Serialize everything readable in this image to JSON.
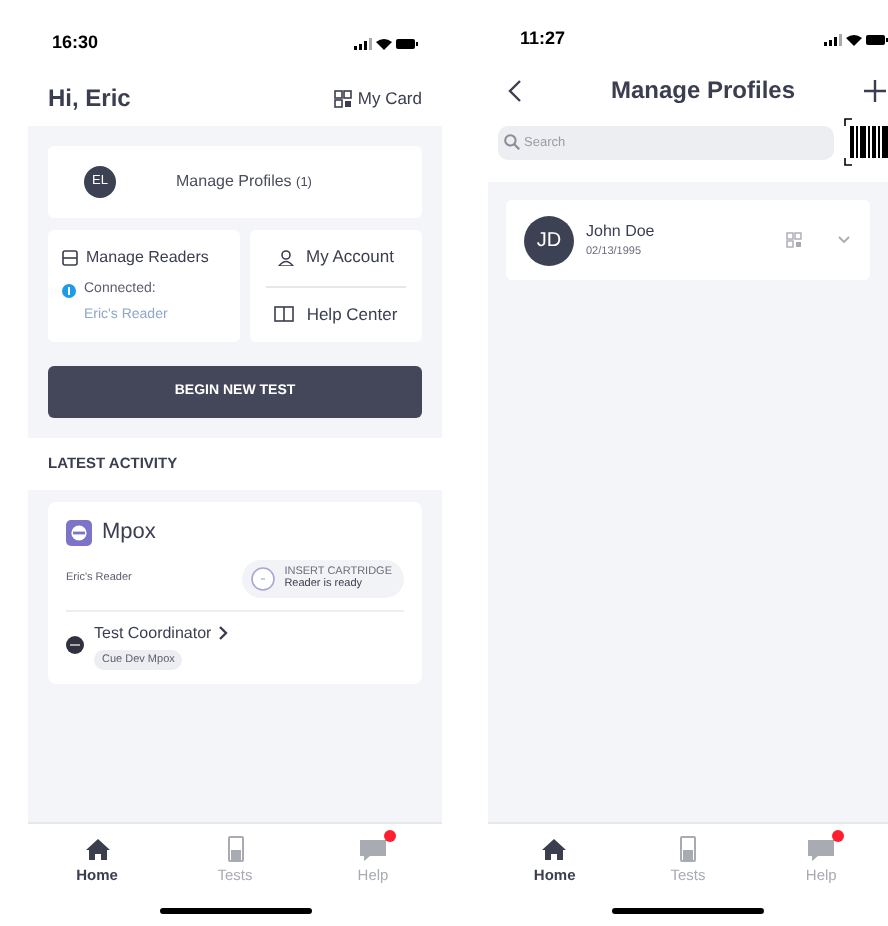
{
  "home_screen": {
    "time": "16:30",
    "greeting": "Hi, Eric",
    "my_card": "My Card",
    "profiles_card": {
      "initials": "EL",
      "label": "Manage Profiles",
      "count": "(1)"
    },
    "readers_card": {
      "label": "Manage Readers",
      "connected": true,
      "status": "Connected:",
      "reader": "Eric's Reader"
    },
    "links": [
      {
        "label": "My Account",
        "kind": "account"
      },
      {
        "label": "Help Center",
        "kind": "help"
      }
    ],
    "primary_button": "BEGIN NEW TEST",
    "section_title": "LATEST ACTIVITY",
    "activity": {
      "title": "Mpox",
      "reader": "Eric's Reader",
      "status": "INSERT CARTRIDGE",
      "substatus": "Reader is ready",
      "coordinator": "Test Coordinator",
      "tag": "Cue Dev Mpox"
    },
    "tab_bar": [
      {
        "label": "Home",
        "kind": "home",
        "selected": true,
        "notification": false
      },
      {
        "label": "Tests",
        "kind": "tests",
        "selected": false,
        "notification": false
      },
      {
        "label": "Help",
        "kind": "help",
        "selected": false,
        "notification": true
      }
    ]
  },
  "profiles_screen": {
    "time": "11:27",
    "title": "Manage Profiles",
    "search": {
      "placeholder": "Search"
    },
    "profiles": [
      {
        "initials": "JD",
        "name": "John Doe",
        "birth_date": "02/13/1995"
      }
    ],
    "tab_bar": [
      {
        "label": "Home",
        "kind": "home",
        "selected": true,
        "notification": false
      },
      {
        "label": "Tests",
        "kind": "tests",
        "selected": false,
        "notification": false
      },
      {
        "label": "Help",
        "kind": "help",
        "selected": false,
        "notification": true
      }
    ]
  }
}
